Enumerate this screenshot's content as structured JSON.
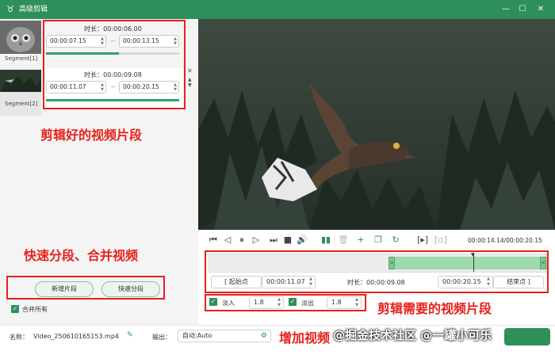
{
  "window": {
    "title": "高级剪辑"
  },
  "segments": [
    {
      "label": "Segment[1]",
      "duration": "时长：00:00:06.00",
      "start": "00:00:07.15",
      "end": "00:00:13.15",
      "progress": 0.55
    },
    {
      "label": "Segment[2]",
      "duration": "时长：00:00:09.08",
      "start": "00:00:11.07",
      "end": "00:00:20.15",
      "progress": 1.0
    }
  ],
  "left_actions": {
    "add_segment": "新增片段",
    "quick_split": "快速分段",
    "merge_all": "合并所有"
  },
  "annotations": {
    "clips_done": "剪辑好的视频片段",
    "split_merge": "快速分段、合并视频",
    "clip_needed": "剪辑需要的视频片段",
    "add_fade": "增加视频"
  },
  "player": {
    "time": "00:00:14.14/00:00:20.15",
    "playhead": 0.78
  },
  "trim": {
    "start_btn": "[ 起始点",
    "start_time": "00:00:11.07",
    "duration": "时长：00:00:09.08",
    "end_time": "00:00:20.15",
    "end_btn": "结束点 ]"
  },
  "fade": {
    "in_label": "淡入",
    "in_value": "1.8",
    "out_label": "淡出",
    "out_value": "1.8"
  },
  "footer": {
    "name_label": "名称：",
    "name_value": "Video_250610165153.mp4",
    "output_label": "输出：",
    "output_value": "自动;Auto",
    "watermark": "@掘金技术社区 @一罐小可乐"
  },
  "colors": {
    "brand": "#2f8f5b",
    "annotation": "#e8201c",
    "range": "#9fd9ae"
  }
}
